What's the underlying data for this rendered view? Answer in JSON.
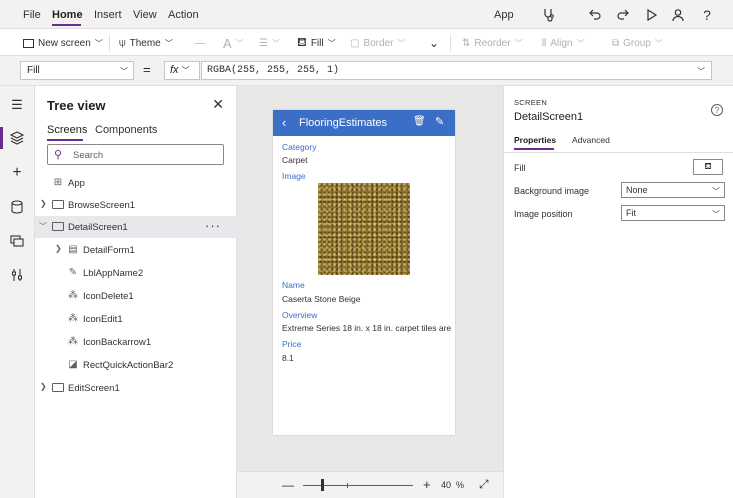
{
  "menu": {
    "items": [
      "File",
      "Home",
      "Insert",
      "View",
      "Action"
    ],
    "active": "Home",
    "right_label": "App",
    "right_icons": [
      "stethoscope-icon",
      "undo-icon",
      "redo-icon",
      "play-icon",
      "person-icon",
      "help-icon"
    ]
  },
  "ribbon": {
    "new_screen": "New screen",
    "theme": "Theme",
    "fill": "Fill",
    "border": "Border",
    "reorder": "Reorder",
    "align": "Align",
    "group": "Group"
  },
  "formula_bar": {
    "property": "Fill",
    "equals": "=",
    "fx": "fx",
    "formula": "RGBA(255, 255, 255, 1)"
  },
  "tree": {
    "title": "Tree view",
    "tabs": [
      "Screens",
      "Components"
    ],
    "active_tab": "Screens",
    "search_placeholder": "Search",
    "rows": [
      {
        "label": "App"
      },
      {
        "label": "BrowseScreen1"
      },
      {
        "label": "DetailScreen1"
      },
      {
        "label": "DetailForm1"
      },
      {
        "label": "LblAppName2"
      },
      {
        "label": "IconDelete1"
      },
      {
        "label": "IconEdit1"
      },
      {
        "label": "IconBackarrow1"
      },
      {
        "label": "RectQuickActionBar2"
      },
      {
        "label": "EditScreen1"
      }
    ],
    "more": "···"
  },
  "app_preview": {
    "header_title": "FlooringEstimates",
    "fields": [
      {
        "label": "Category",
        "value": "Carpet"
      },
      {
        "label": "Image",
        "value": ""
      },
      {
        "label": "Name",
        "value": "Caserta Stone Beige"
      },
      {
        "label": "Overview",
        "value": "Extreme Series 18 in. x 18 in. carpet tiles are"
      },
      {
        "label": "Price",
        "value": "8.1"
      }
    ]
  },
  "zoom": {
    "value": "40",
    "unit": "%",
    "level": 0.4
  },
  "properties": {
    "kind": "SCREEN",
    "name": "DetailScreen1",
    "tabs": [
      "Properties",
      "Advanced"
    ],
    "active_tab": "Properties",
    "rows": [
      {
        "label": "Fill"
      },
      {
        "label": "Background image",
        "value": "None"
      },
      {
        "label": "Image position",
        "value": "Fit"
      }
    ]
  }
}
